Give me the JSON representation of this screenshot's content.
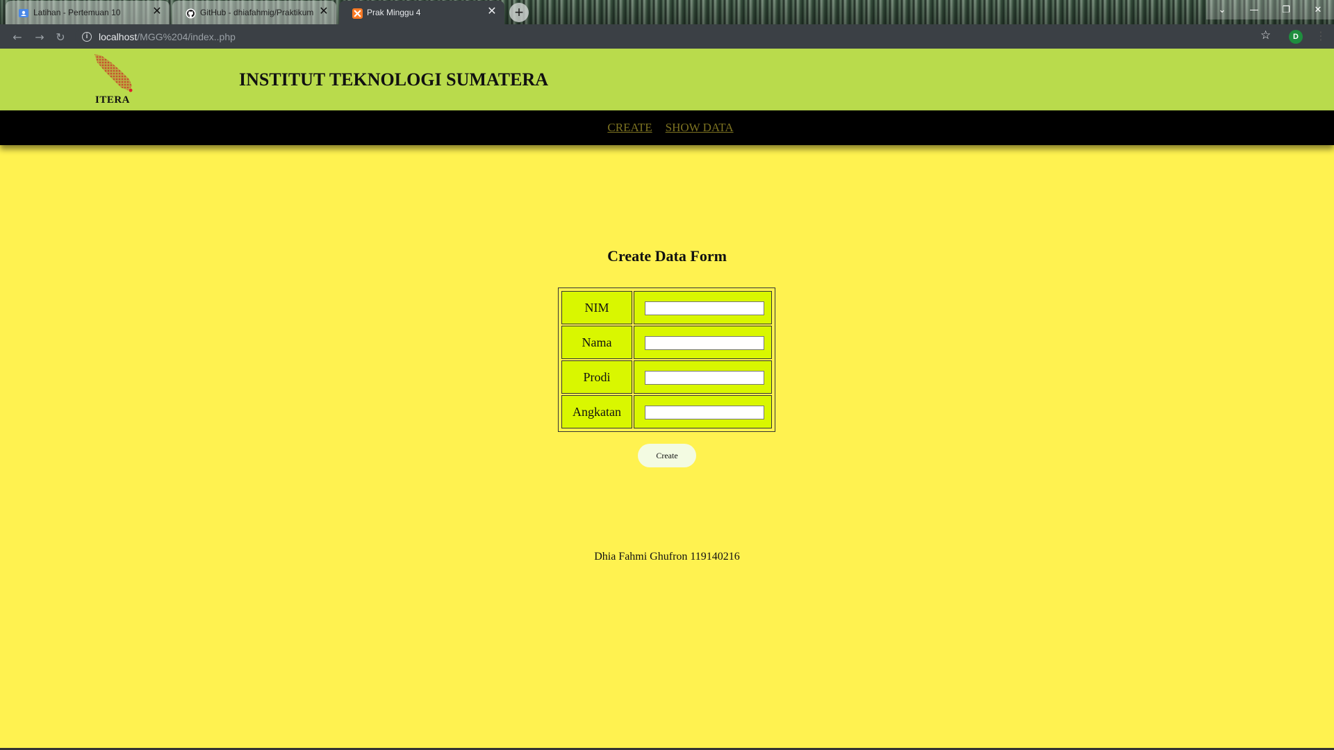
{
  "browser": {
    "tabs": [
      {
        "title": "Latihan - Pertemuan 10",
        "icon": "classroom-icon"
      },
      {
        "title": "GitHub - dhiafahmig/Praktikum",
        "icon": "github-icon"
      },
      {
        "title": "Prak Minggu 4",
        "icon": "xampp-icon",
        "active": true
      }
    ],
    "new_tab": "+",
    "url_host": "localhost",
    "url_path": "/MGG%204/index..php",
    "profile_initial": "D"
  },
  "site": {
    "logo_text": "ITERA",
    "title": "INSTITUT TEKNOLOGI SUMATERA",
    "nav": {
      "create": "CREATE",
      "show_data": "SHOW DATA"
    }
  },
  "form": {
    "title": "Create Data Form",
    "fields": [
      {
        "label": "NIM",
        "value": ""
      },
      {
        "label": "Nama",
        "value": ""
      },
      {
        "label": "Prodi",
        "value": ""
      },
      {
        "label": "Angkatan",
        "value": ""
      }
    ],
    "submit_label": "Create"
  },
  "footer": {
    "text": "Dhia Fahmi Ghufron 119140216"
  },
  "colors": {
    "page_bg": "#fff250",
    "header_bg": "#b9db4c",
    "navbar_bg": "#000000",
    "nav_link": "#7d7321",
    "cell_bg": "#d9f700",
    "button_bg": "#f3fbe2"
  }
}
